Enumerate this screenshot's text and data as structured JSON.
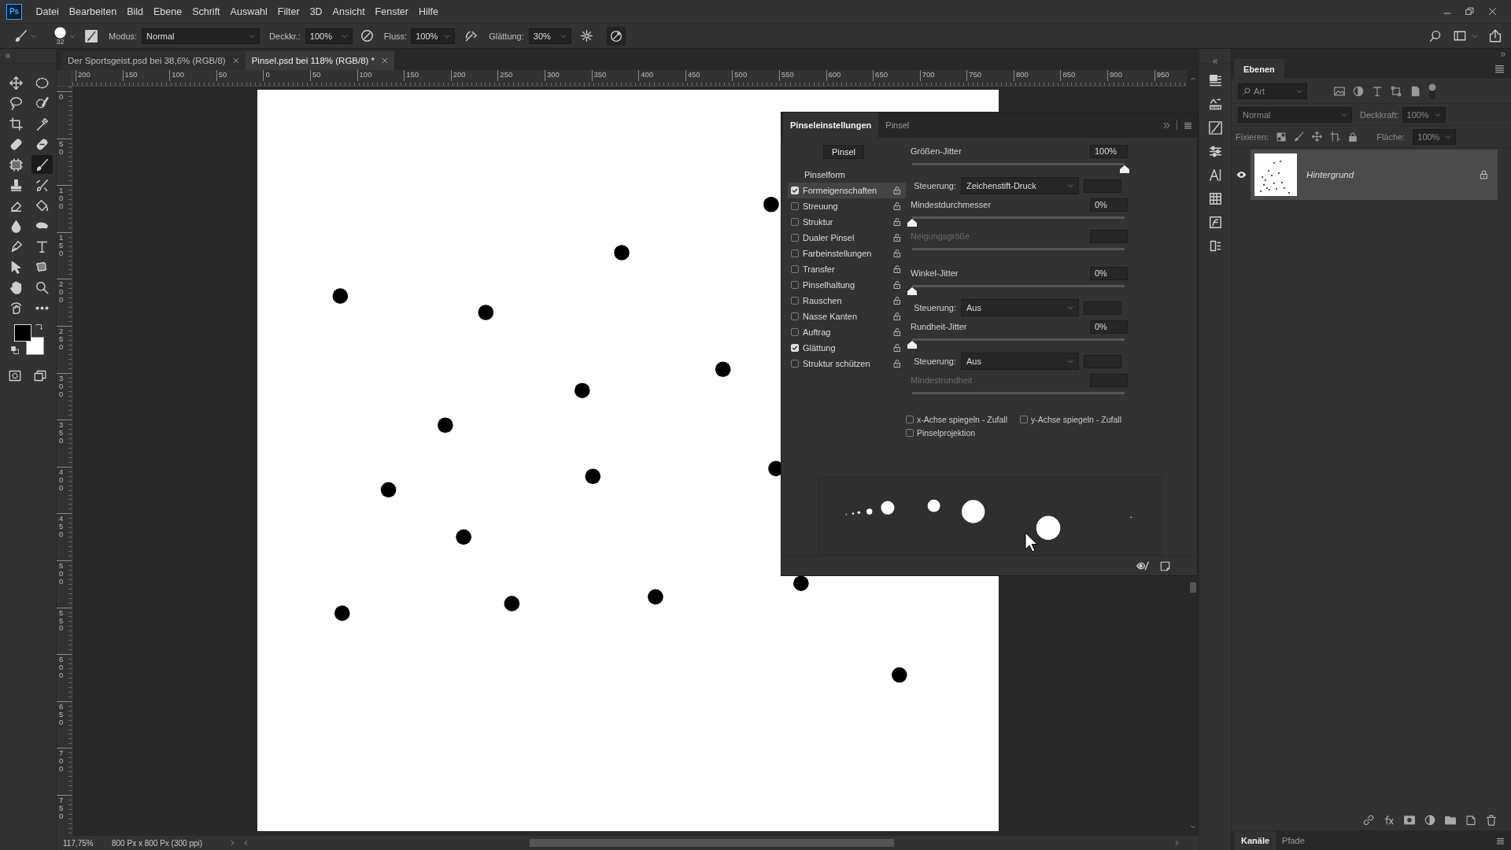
{
  "app": {
    "logo": "Ps"
  },
  "menu": [
    "Datei",
    "Bearbeiten",
    "Bild",
    "Ebene",
    "Schrift",
    "Auswahl",
    "Filter",
    "3D",
    "Ansicht",
    "Fenster",
    "Hilfe"
  ],
  "options_bar": {
    "brush_size": "32",
    "mode_label": "Modus:",
    "mode": "Normal",
    "opacity_label": "Deckkr.:",
    "opacity": "100%",
    "flow_label": "Fluss:",
    "flow": "100%",
    "smoothing_label": "Glättung:",
    "smoothing": "30%"
  },
  "toolbar": {
    "tools": [
      {
        "kind": "move",
        "selected": false
      },
      {
        "kind": "marquee",
        "selected": false
      },
      {
        "kind": "lasso",
        "selected": false
      },
      {
        "kind": "quickselect",
        "selected": false
      },
      {
        "kind": "crop",
        "selected": false
      },
      {
        "kind": "eyedropper",
        "selected": false
      },
      {
        "kind": "healing",
        "selected": false
      },
      {
        "kind": "patch",
        "selected": false
      },
      {
        "kind": "frame",
        "selected": false
      },
      {
        "kind": "brush",
        "selected": true
      },
      {
        "kind": "stamp",
        "selected": false
      },
      {
        "kind": "mixer",
        "selected": false
      },
      {
        "kind": "eraser",
        "selected": false
      },
      {
        "kind": "bucket",
        "selected": false
      },
      {
        "kind": "blur",
        "selected": false
      },
      {
        "kind": "smudge",
        "selected": false
      },
      {
        "kind": "pen",
        "selected": false
      },
      {
        "kind": "type",
        "selected": false
      },
      {
        "kind": "select",
        "selected": false
      },
      {
        "kind": "shape",
        "selected": false
      },
      {
        "kind": "hand",
        "selected": false
      },
      {
        "kind": "zoom",
        "selected": false
      },
      {
        "kind": "rotate",
        "selected": false
      },
      {
        "kind": "more",
        "selected": false
      }
    ]
  },
  "document_tabs": [
    {
      "title": "Der Sportsgeist.psd bei 38,6% (RGB/8)",
      "selected": false
    },
    {
      "title": "Pinsel.psd bei 118% (RGB/8) *",
      "selected": true
    }
  ],
  "rulers": {
    "horizontal": [
      "200",
      "150",
      "100",
      "50",
      "0",
      "50",
      "100",
      "150",
      "200",
      "250",
      "300",
      "350",
      "400",
      "450",
      "500",
      "550",
      "600",
      "650",
      "700",
      "750",
      "800",
      "850",
      "900",
      "950"
    ],
    "vertical": [
      "0",
      "50",
      "100",
      "150",
      "200",
      "250",
      "300",
      "350",
      "400",
      "450",
      "500",
      "550",
      "600",
      "650",
      "700",
      "750"
    ]
  },
  "brush_settings": {
    "tabs": [
      {
        "label": "Pinseleinstellungen",
        "selected": true
      },
      {
        "label": "Pinsel",
        "selected": false
      }
    ],
    "presets_button": "Pinsel",
    "tip_shape": "Pinselform",
    "sections": [
      {
        "label": "Formeigenschaften",
        "checked": true,
        "selected": true
      },
      {
        "label": "Streuung",
        "checked": false,
        "selected": false
      },
      {
        "label": "Struktur",
        "checked": false,
        "selected": false
      },
      {
        "label": "Dualer Pinsel",
        "checked": false,
        "selected": false
      },
      {
        "label": "Farbeinstellungen",
        "checked": false,
        "selected": false
      },
      {
        "label": "Transfer",
        "checked": false,
        "selected": false
      },
      {
        "label": "Pinselhaltung",
        "checked": false,
        "selected": false
      },
      {
        "label": "Rauschen",
        "checked": false,
        "selected": false
      },
      {
        "label": "Nasse Kanten",
        "checked": false,
        "selected": false
      },
      {
        "label": "Auftrag",
        "checked": false,
        "selected": false
      },
      {
        "label": "Glättung",
        "checked": true,
        "selected": false
      },
      {
        "label": "Struktur schützen",
        "checked": false,
        "selected": false
      }
    ],
    "settings": [
      {
        "kind": "slider",
        "label": "Größen-Jitter",
        "value": "100%",
        "level": 1,
        "disabled": false
      },
      {
        "kind": "control",
        "label": "Steuerung:",
        "value": "Zeichenstift-Druck"
      },
      {
        "kind": "slider",
        "label": "Mindestdurchmesser",
        "value": "0%",
        "level": 0,
        "disabled": false
      },
      {
        "kind": "slider",
        "label": "Neigungsgröße",
        "disabled": true
      },
      {
        "kind": "slider",
        "label": "Winkel-Jitter",
        "value": "0%",
        "level": 0,
        "disabled": false
      },
      {
        "kind": "control",
        "label": "Steuerung:",
        "value": "Aus"
      },
      {
        "kind": "slider",
        "label": "Rundheit-Jitter",
        "value": "0%",
        "level": 0,
        "disabled": false
      },
      {
        "kind": "control",
        "label": "Steuerung:",
        "value": "Aus"
      },
      {
        "kind": "slider",
        "label": "Mindestrundheit",
        "disabled": true
      }
    ],
    "options": [
      {
        "label": "x-Achse spiegeln - Zufall",
        "checked": false
      },
      {
        "label": "y-Achse spiegeln - Zufall",
        "checked": false
      },
      {
        "label": "Pinselprojektion",
        "checked": false
      }
    ]
  },
  "layers_panel": {
    "tab": "Ebenen",
    "filter": "Art",
    "blend_mode": "Normal",
    "opacity_label": "Deckkraft:",
    "opacity": "100%",
    "lock_label": "Fixieren:",
    "fill_label": "Fläche:",
    "fill": "100%",
    "layers": [
      {
        "name": "Hintergrund",
        "visible": true,
        "selected": true,
        "locked": true
      }
    ],
    "bottom_tabs": [
      {
        "label": "Kanäle",
        "selected": true
      },
      {
        "label": "Pfade",
        "selected": false
      }
    ]
  },
  "status_bar": {
    "zoom": "117,75%",
    "document_info": "800 Px x 800 Px (300 ppi)"
  }
}
